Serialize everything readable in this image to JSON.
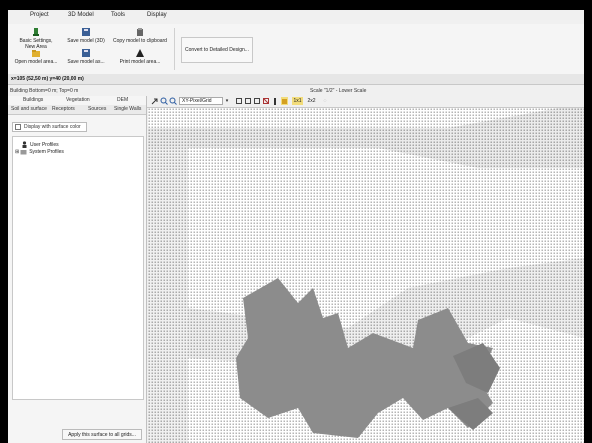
{
  "menu": {
    "tabs": [
      "Project",
      "3D Model",
      "Tools",
      "Display"
    ]
  },
  "ribbon": {
    "basic_settings": "Basic Settings, New Area",
    "open_model": "Open model area...",
    "save_model_3d": "Save model (3D)",
    "save_model_as": "Save model as...",
    "copy_model": "Copy model to clipboard",
    "print_model": "Print model area...",
    "convert": "Convert to Detailed Design..."
  },
  "coords_text": "x=105 (52,50 m) y=40 (20,00 m)",
  "building_info": "Building Bottom=0 m; Top=0 m",
  "scale_text": "Scale \"1/2\" - Lower Scale",
  "left_panel": {
    "tabs_row1": [
      "Buildings",
      "Vegetation",
      "DEM"
    ],
    "tabs_row2": [
      "Soil and surface",
      "Receptors",
      "Sources",
      "Single Walls"
    ],
    "display_checkbox": "Display with surface color",
    "tree": [
      "User Profiles",
      "System Profiles"
    ],
    "apply_button": "Apply this surface to all grids..."
  },
  "view_toolbar": {
    "dropdown_value": "XY-Pixel/Grid",
    "btn_1x1": "1x1",
    "btn_2x2": "2x2"
  },
  "colors": {
    "grid_char": "#9a9a9a",
    "surface_gray": "#8c8c8c",
    "light_band": "#cfcfcf",
    "highlight": "#f2dc7a"
  }
}
